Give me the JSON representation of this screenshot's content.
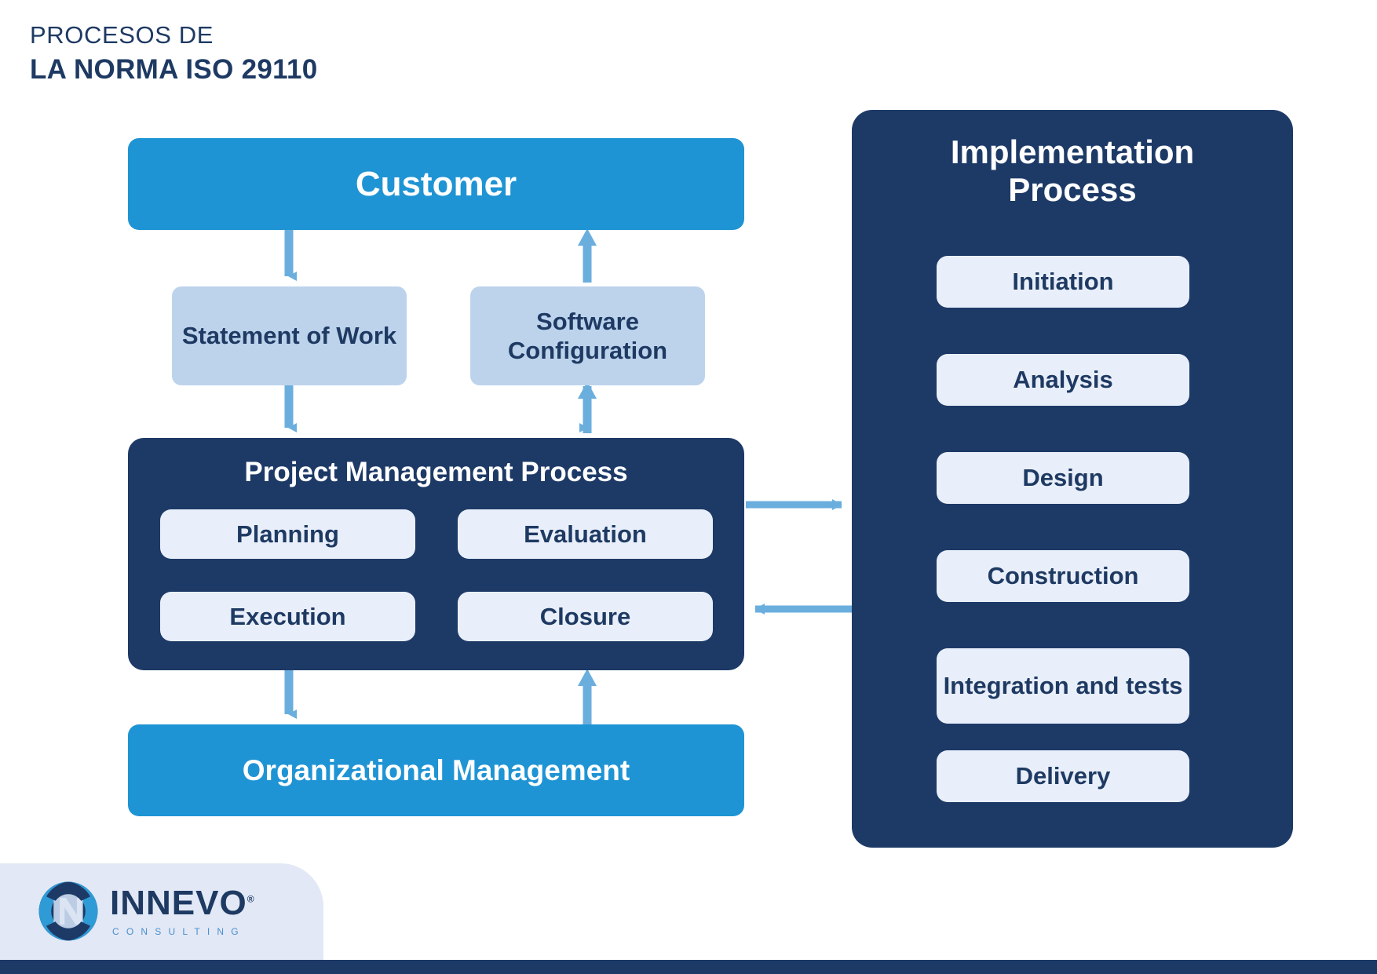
{
  "title": {
    "line1": "PROCESOS DE",
    "line2": "LA NORMA ISO 29110"
  },
  "diagram": {
    "customer": "Customer",
    "statement_of_work": "Statement of Work",
    "software_configuration": "Software Configuration",
    "project_management": {
      "title": "Project Management Process",
      "activities": [
        "Planning",
        "Evaluation",
        "Execution",
        "Closure"
      ]
    },
    "organizational_management": "Organizational Management",
    "implementation": {
      "title": "Implementation Process",
      "steps": [
        "Initiation",
        "Analysis",
        "Design",
        "Construction",
        "Integration and tests",
        "Delivery"
      ]
    }
  },
  "colors": {
    "primary_blue": "#1f94d4",
    "navy": "#1d3a67",
    "soft_blue": "#bdd3ec",
    "pill_bg": "#e9effa",
    "arrow": "#6aaede",
    "logo_panel": "#e2e8f5"
  },
  "logo": {
    "wordmark": "INNEVO",
    "registered": "®",
    "tagline": "CONSULTING"
  }
}
